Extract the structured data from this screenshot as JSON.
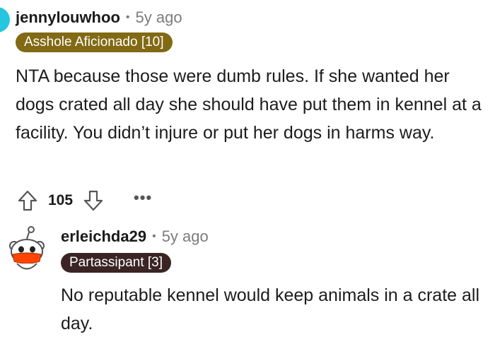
{
  "comment1": {
    "username": "jennylouwhoo",
    "separator": "•",
    "age": "5y ago",
    "flair": "Asshole Aficionado [10]",
    "body": "NTA because those were dumb rules. If she wanted her dogs crated all day she should have put them in kennel at a facility. You didn’t injure or put her dogs in harms way.",
    "score": "105",
    "more": "•••"
  },
  "comment2": {
    "username": "erleichda29",
    "separator": "•",
    "age": "5y ago",
    "flair": "Partassipant [3]",
    "body": "No reputable kennel would keep animals in a crate all day."
  },
  "colors": {
    "flair_gold": "#826a14",
    "flair_dark": "#3a2424",
    "avatar_teal": "#27c6e0",
    "avatar_orange": "#ff4500"
  },
  "icons": {
    "upvote": "upvote-arrow-icon",
    "downvote": "downvote-arrow-icon",
    "avatar": "snoo-avatar-icon"
  }
}
